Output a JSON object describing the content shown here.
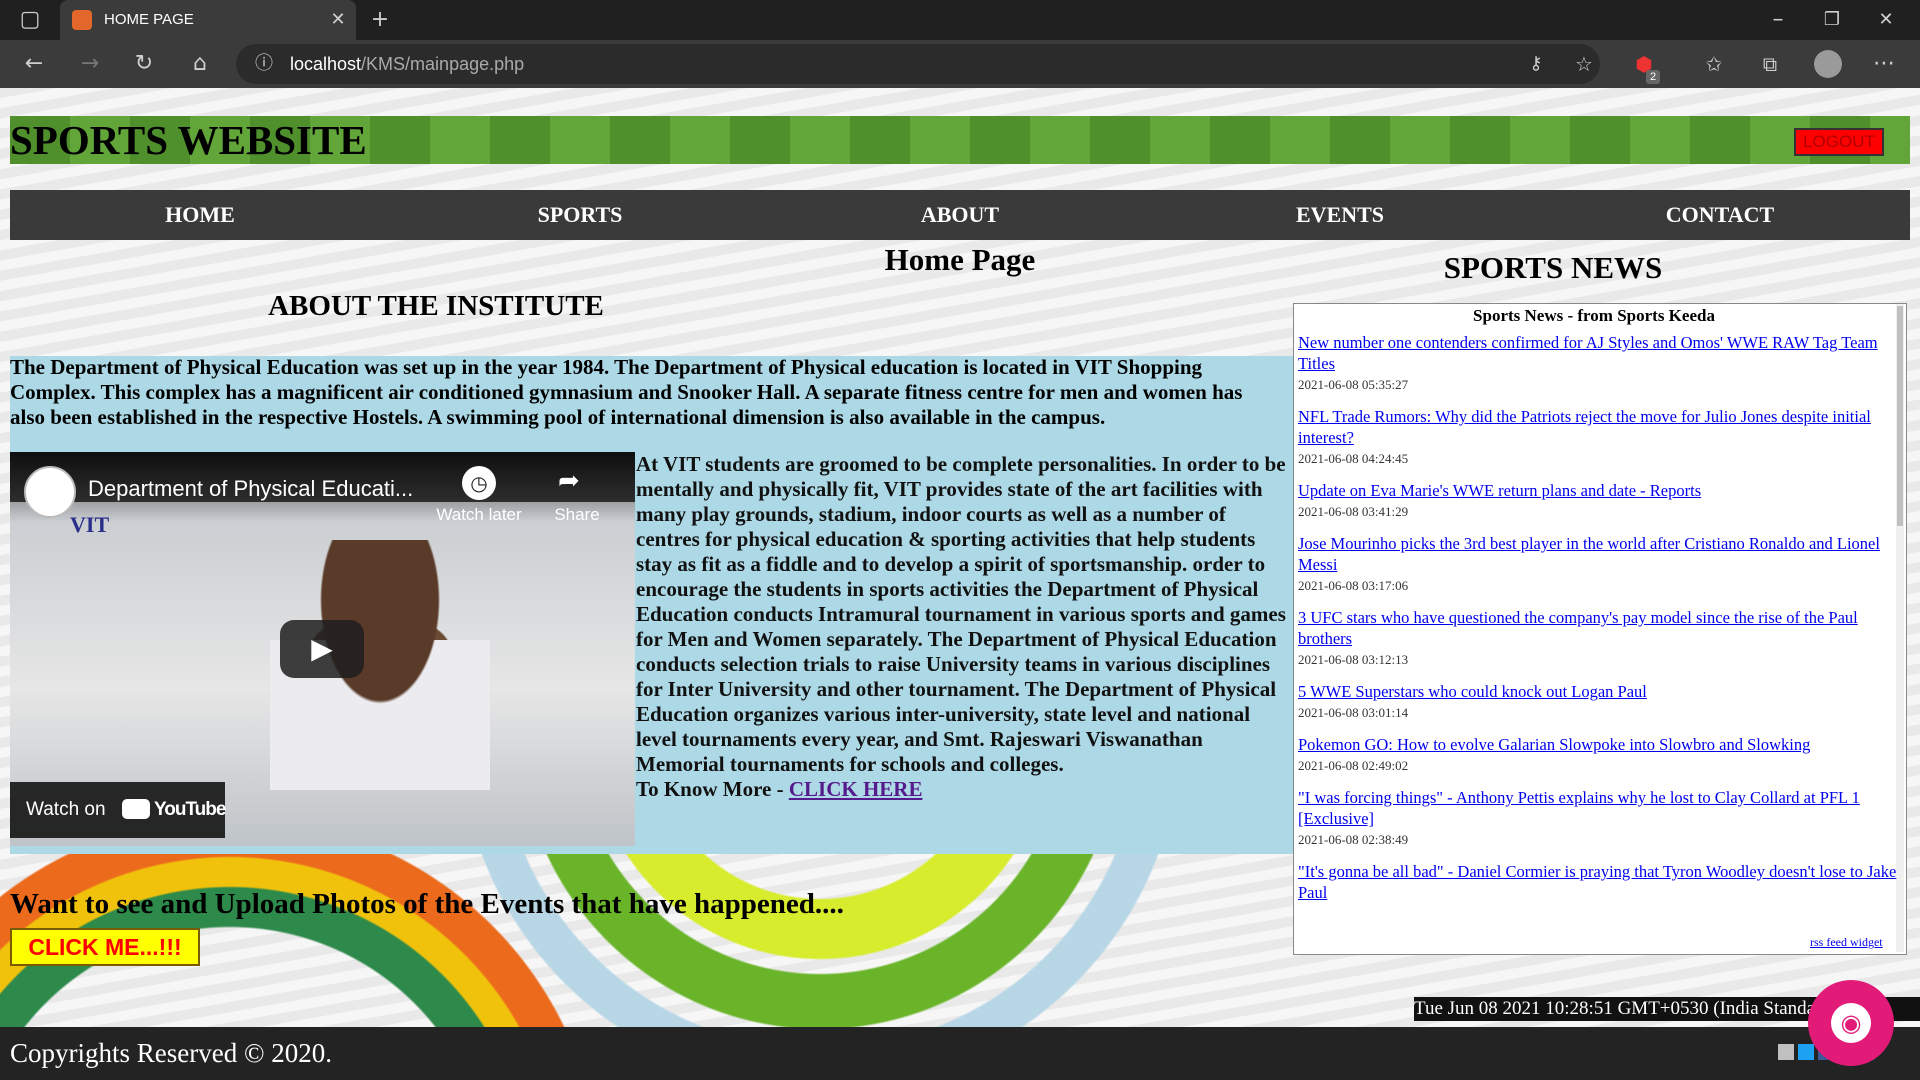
{
  "browser": {
    "tab_title": "HOME PAGE",
    "new_tab": "+",
    "url_host": "localhost",
    "url_path": "/KMS/mainpage.php",
    "extension_badge": "2",
    "window_controls": [
      "minimize-icon",
      "restore-icon",
      "close-icon"
    ]
  },
  "header": {
    "site_title": "SPORTS WEBSITE",
    "logout_label": "LOGOUT"
  },
  "nav": {
    "items": [
      "HOME",
      "SPORTS",
      "ABOUT",
      "EVENTS",
      "CONTACT"
    ]
  },
  "main": {
    "page_heading": "Home Page",
    "about_heading": "ABOUT THE INSTITUTE",
    "intro": "The Department of Physical Education was set up in the year 1984. The Department of Physical education is located in VIT Shopping Complex. This complex has a magnificent air conditioned gymnasium and Snooker Hall. A separate fitness centre for men and women has also been established in the respective Hostels. A swimming pool of international dimension is also available in the campus.",
    "body": "At VIT students are groomed to be complete personalities. In order to be mentally and physically fit, VIT provides state of the art facilities with many play grounds, stadium, indoor courts as well as a number of centres for physical education & sporting activities that help students stay as fit as a fiddle and to develop a spirit of sportsmanship. order to encourage the students in sports activities the Department of Physical Education conducts Intramural tournament in various sports and games for Men and Women separately. The Department of Physical Education conducts selection trials to raise University teams in various disciplines for Inter University and other tournament. The Department of Physical Education organizes various inter-university, state level and national level tournaments every year, and Smt. Rajeswari Viswanathan Memorial tournaments for schools and colleges.",
    "know_more_prefix": "To Know More - ",
    "know_more_link": "CLICK HERE",
    "upload_text": "Want to see and Upload Photos of the Events that have happened....",
    "click_me": "CLICK ME...!!!"
  },
  "video": {
    "title": "Department of Physical Educati...",
    "watch_later": "Watch later",
    "share": "Share",
    "watch_on": "Watch on",
    "youtube": "YouTube",
    "channel_text": "VIT"
  },
  "news": {
    "heading": "SPORTS NEWS",
    "caption": "Sports News - from Sports Keeda",
    "credit": "rss feed widget",
    "items": [
      {
        "title": "New number one contenders confirmed for AJ Styles and Omos' WWE RAW Tag Team Titles",
        "date": "2021-06-08 05:35:27"
      },
      {
        "title": "NFL Trade Rumors: Why did the Patriots reject the move for Julio Jones despite initial interest?",
        "date": "2021-06-08 04:24:45"
      },
      {
        "title": "Update on Eva Marie's WWE return plans and date - Reports",
        "date": "2021-06-08 03:41:29"
      },
      {
        "title": "Jose Mourinho picks the 3rd best player in the world after Cristiano Ronaldo and Lionel Messi",
        "date": "2021-06-08 03:17:06"
      },
      {
        "title": "3 UFC stars who have questioned the company's pay model since the rise of the Paul brothers",
        "date": "2021-06-08 03:12:13"
      },
      {
        "title": "5 WWE Superstars who could knock out Logan Paul",
        "date": "2021-06-08 03:01:14"
      },
      {
        "title": "Pokemon GO: How to evolve Galarian Slowpoke into Slowbro and Slowking",
        "date": "2021-06-08 02:49:02"
      },
      {
        "title": "\"I was forcing things\" - Anthony Pettis explains why he lost to Clay Collard at PFL 1 [Exclusive]",
        "date": "2021-06-08 02:38:49"
      },
      {
        "title": "\"It's gonna be all bad\" - Daniel Cormier is praying that Tyron Woodley doesn't lose to Jake Paul",
        "date": ""
      }
    ]
  },
  "footer": {
    "datetime": "Tue Jun 08 2021 10:28:51 GMT+0530 (India Standard Time)",
    "copyright": "Copyrights Reserved © 2020.",
    "social_icons": [
      "instagram-icon",
      "twitter-icon",
      "facebook-icon",
      "youtube-icon",
      "linkedin-icon"
    ]
  },
  "colors": {
    "nav_bg": "#3a3a3a",
    "content_bg": "#add8e6",
    "logout_bg": "#ff0000",
    "click_me_bg": "#ffff00",
    "click_me_text": "#ff0000",
    "chat_button": "#e21b78"
  }
}
